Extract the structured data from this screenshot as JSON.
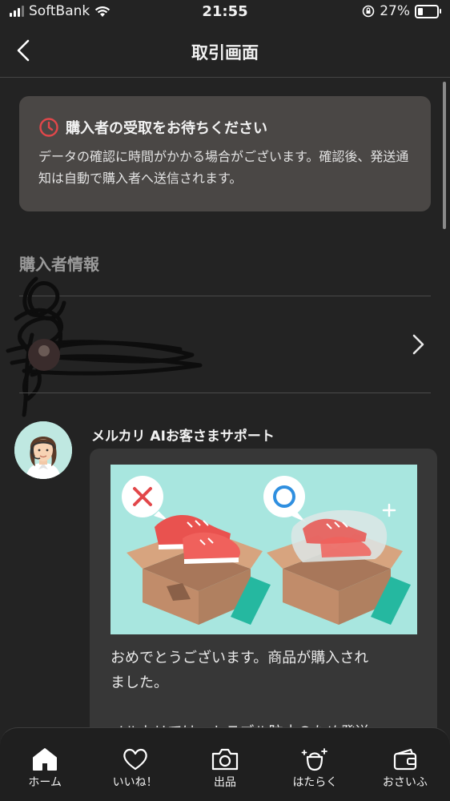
{
  "status_bar": {
    "carrier": "SoftBank",
    "time": "21:55",
    "battery": "27%"
  },
  "nav": {
    "title": "取引画面"
  },
  "notice": {
    "title": "購入者の受取をお待ちください",
    "body": "データの確認に時間がかかる場合がございます。確認後、発送通知は自動で購入者へ送信されます。"
  },
  "buyer_section": {
    "label": "購入者情報"
  },
  "support": {
    "name": "メルカリ AIお客さまサポート",
    "message_line1": "おめでとうございます。商品が購入され",
    "message_line2": "ました。",
    "message_line3": "メルカリでは、トラブル防止のため発送"
  },
  "tabs": [
    {
      "label": "ホーム",
      "icon": "home-icon"
    },
    {
      "label": "いいね！",
      "icon": "heart-icon"
    },
    {
      "label": "出品",
      "icon": "camera-icon"
    },
    {
      "label": "はたらく",
      "icon": "work-bag-icon"
    },
    {
      "label": "おさいふ",
      "icon": "wallet-icon"
    }
  ],
  "colors": {
    "background": "#232323",
    "notice_bg": "#4a4745",
    "clock_red": "#e2474a",
    "illustration_bg": "#a8e6df"
  }
}
